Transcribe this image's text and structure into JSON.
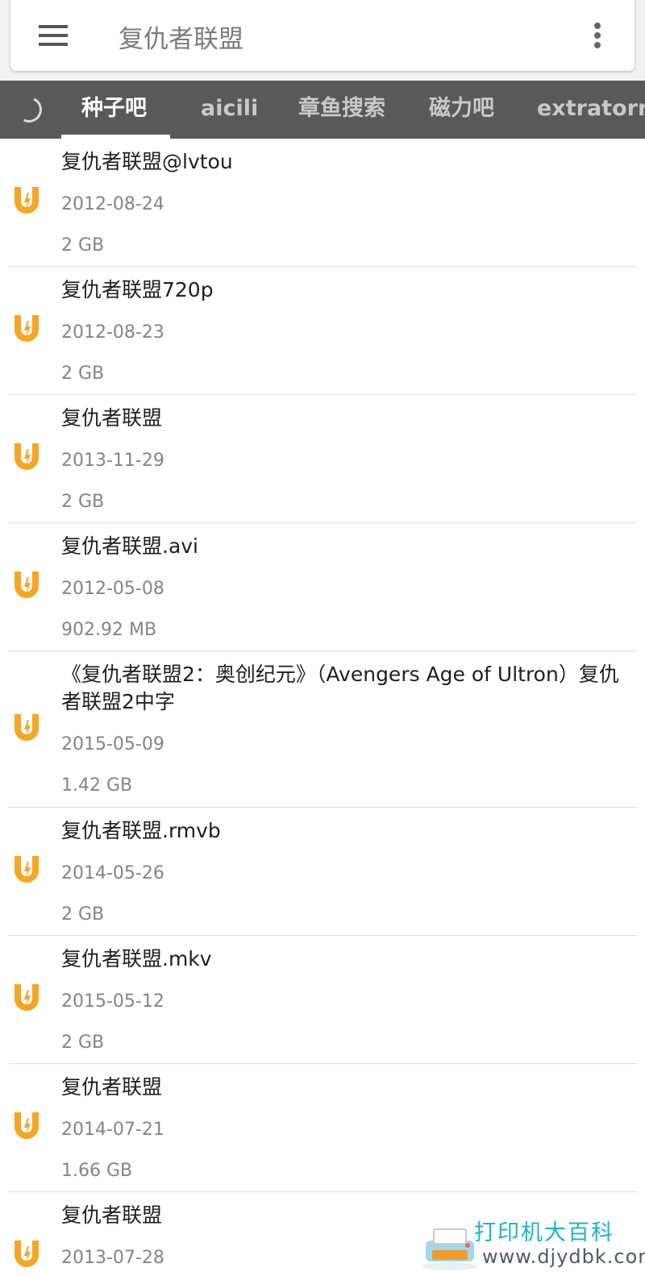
{
  "search": {
    "query": "复仇者联盟"
  },
  "icons": {
    "menu": "hamburger-menu-icon",
    "more": "more-vert-icon",
    "refresh": "refresh-spinner-icon",
    "result": "magnet-icon"
  },
  "colors": {
    "toolbar": "#595959",
    "accent": "#f5a623",
    "tab_active": "#ffffff",
    "tab_inactive": "#c9c9c9"
  },
  "tabs": [
    {
      "label": "种子吧",
      "active": true
    },
    {
      "label": "aicili",
      "active": false
    },
    {
      "label": "章鱼搜索",
      "active": false
    },
    {
      "label": "磁力吧",
      "active": false
    },
    {
      "label": "extratorre",
      "active": false
    }
  ],
  "results": [
    {
      "title": "复仇者联盟@lvtou",
      "date": "2012-08-24",
      "size": "2 GB"
    },
    {
      "title": "复仇者联盟720p",
      "date": "2012-08-23",
      "size": "2 GB"
    },
    {
      "title": "复仇者联盟",
      "date": "2013-11-29",
      "size": "2 GB"
    },
    {
      "title": "复仇者联盟.avi",
      "date": "2012-05-08",
      "size": "902.92 MB"
    },
    {
      "title": "《复仇者联盟2：奥创纪元》（Avengers Age of Ultron）复仇者联盟2中字",
      "date": "2015-05-09",
      "size": "1.42 GB"
    },
    {
      "title": "复仇者联盟.rmvb",
      "date": "2014-05-26",
      "size": "2 GB"
    },
    {
      "title": "复仇者联盟.mkv",
      "date": "2015-05-12",
      "size": "2 GB"
    },
    {
      "title": "复仇者联盟",
      "date": "2014-07-21",
      "size": "1.66 GB"
    },
    {
      "title": "复仇者联盟",
      "date": "2013-07-28",
      "size": ""
    }
  ],
  "watermark": {
    "line1": "打印机大百科",
    "line2": "www.djydbk.com"
  }
}
